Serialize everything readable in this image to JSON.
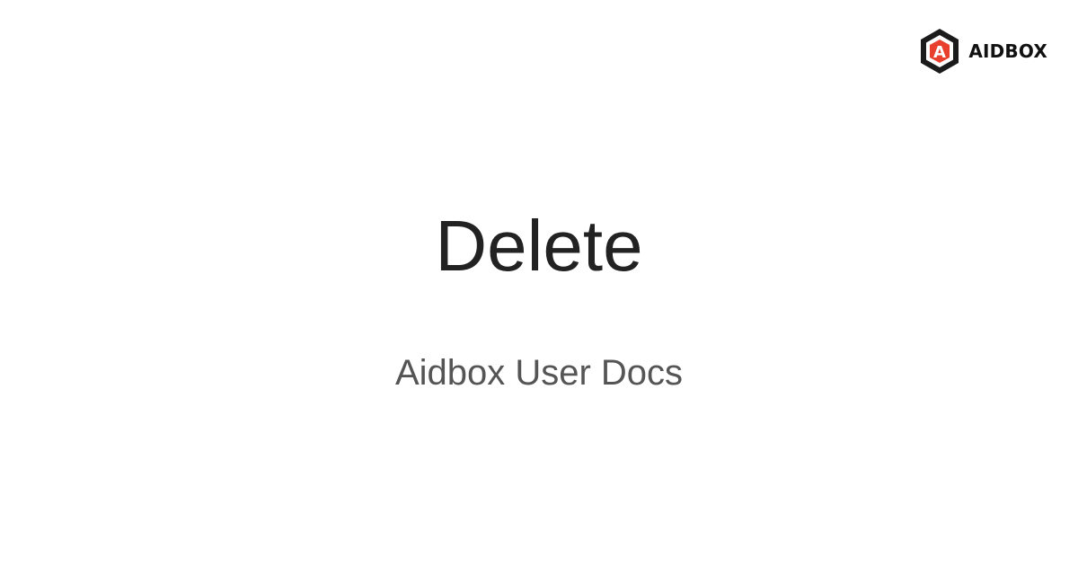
{
  "brand": {
    "name": "AIDBOX",
    "logo_letter": "A",
    "logo_icon": "aidbox-hexagon-logo-icon",
    "accent_color": "#E8402C",
    "dark_color": "#1B1B1B"
  },
  "title": "Delete",
  "subtitle": "Aidbox User Docs"
}
